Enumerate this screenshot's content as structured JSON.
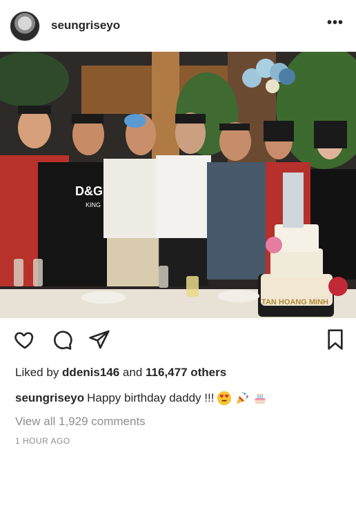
{
  "post": {
    "username": "seungriseyo",
    "more_icon": "more-dots-icon",
    "likes_prefix": "Liked by ",
    "liked_by": "ddenis146",
    "likes_middle": " and ",
    "likes_count": "116,477 others",
    "caption_user": "seungriseyo",
    "caption_text": "Happy birthday daddy !!!",
    "caption_emojis": [
      "heart-eyes-emoji",
      "party-popper-emoji",
      "birthday-cake-emoji"
    ],
    "view_comments": "View all 1,929 comments",
    "timestamp": "1 HOUR AGO"
  },
  "photo": {
    "shirt_text_1": "D&G",
    "shirt_text_2": "KING",
    "cake_text": "TAN HOANG MINH"
  },
  "actions": {
    "like_icon": "heart-icon",
    "comment_icon": "comment-icon",
    "share_icon": "send-icon",
    "save_icon": "bookmark-icon"
  }
}
